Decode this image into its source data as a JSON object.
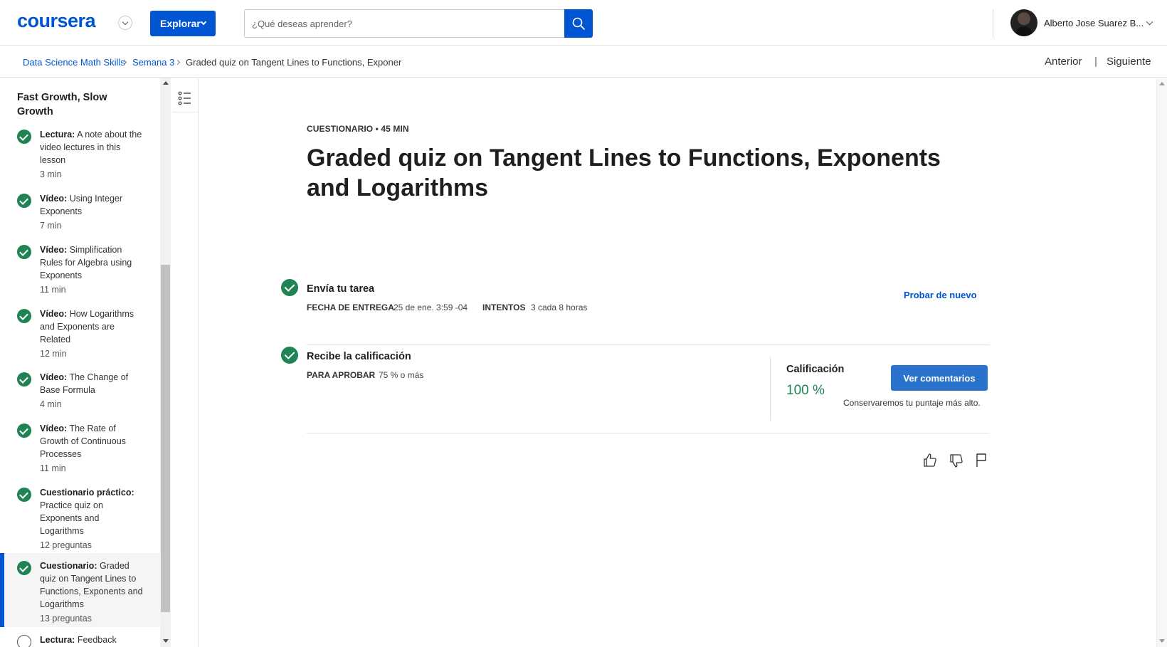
{
  "header": {
    "logo": "coursera",
    "explore_label": "Explorar",
    "search_placeholder": "¿Qué deseas aprender?",
    "user_name": "Alberto Jose Suarez B..."
  },
  "breadcrumb": {
    "items": [
      "Data Science Math Skills",
      "Semana 3",
      "Graded quiz on Tangent Lines to Functions, Exponents and Logarithms"
    ]
  },
  "pager": {
    "prev": "Anterior",
    "sep": "|",
    "next": "Siguiente"
  },
  "sidebar": {
    "title": "Fast Growth, Slow Growth",
    "items": [
      {
        "type": "Lectura:",
        "name": "A note about the video lectures in this lesson",
        "duration": "3 min"
      },
      {
        "type": "Vídeo:",
        "name": "Using Integer Exponents",
        "duration": "7 min"
      },
      {
        "type": "Vídeo:",
        "name": "Simplification Rules for Algebra using Exponents",
        "duration": "11 min"
      },
      {
        "type": "Vídeo:",
        "name": "How Logarithms and Exponents are Related",
        "duration": "12 min"
      },
      {
        "type": "Vídeo:",
        "name": "The Change of Base Formula",
        "duration": "4 min"
      },
      {
        "type": "Vídeo:",
        "name": "The Rate of Growth of Continuous Processes",
        "duration": "11 min"
      },
      {
        "type": "Cuestionario práctico:",
        "name": "Practice quiz on Exponents and Logarithms",
        "duration": "12 preguntas"
      },
      {
        "type": "Cuestionario:",
        "name": "Graded quiz on Tangent Lines to Functions, Exponents and Logarithms",
        "duration": "13 preguntas"
      },
      {
        "type": "Lectura:",
        "name": "Feedback",
        "duration": ""
      }
    ]
  },
  "main": {
    "kicker": "CUESTIONARIO • 45 MIN",
    "title": "Graded quiz on Tangent Lines to Functions, Exponents and Logarithms",
    "submit": {
      "title": "Envía tu tarea",
      "due_label": "FECHA DE ENTREGA",
      "due_value": "25 de ene. 3:59 -04",
      "attempts_label": "INTENTOS",
      "attempts_value": "3 cada 8 horas",
      "retry_label": "Probar de nuevo"
    },
    "grade": {
      "title": "Recibe la calificación",
      "pass_label": "PARA APROBAR",
      "pass_value": "75 % o más",
      "grade_label": "Calificación",
      "grade_value": "100 %",
      "feedback_button": "Ver comentarios",
      "note": "Conservaremos tu puntaje más alto."
    }
  },
  "colors": {
    "brand": "#0056d2",
    "success": "#1f8354",
    "button": "#2a73cc"
  },
  "icons": [
    "chevron-down-icon",
    "search-icon",
    "list-icon",
    "thumbs-up-icon",
    "thumbs-down-icon",
    "flag-icon",
    "check-circle-icon"
  ]
}
